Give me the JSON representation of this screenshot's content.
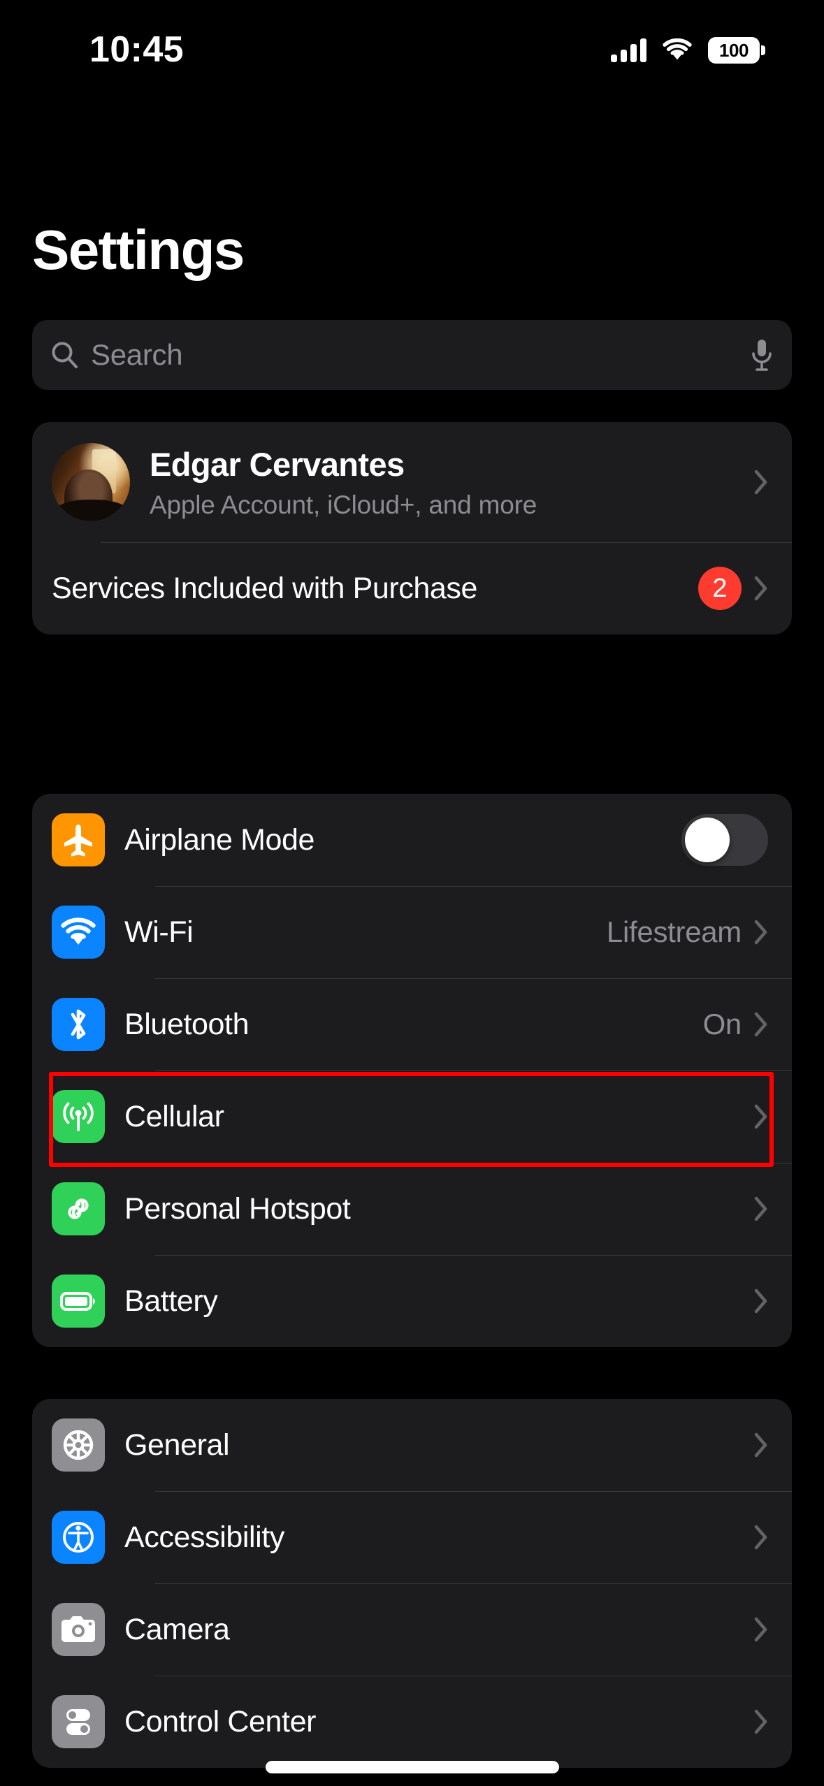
{
  "status_bar": {
    "time": "10:45",
    "signal_icon": "cellular-signal-icon",
    "signal_bars": 4,
    "wifi_icon": "wifi-icon",
    "battery_icon": "battery-icon",
    "battery_percent": "100"
  },
  "header": {
    "title": "Settings"
  },
  "search": {
    "placeholder": "Search",
    "search_icon": "search-icon",
    "mic_icon": "microphone-icon"
  },
  "account_card": {
    "avatar_icon": "user-avatar-photo",
    "name": "Edgar Cervantes",
    "subtitle": "Apple Account, iCloud+, and more",
    "services_label": "Services Included with Purchase",
    "services_badge": "2",
    "badge_color": "#FF3B30",
    "chevron_icon": "chevron-right-icon"
  },
  "connectivity_group": {
    "rows": [
      {
        "label": "Airplane Mode",
        "icon": "airplane-icon",
        "icon_color": "#FF9500",
        "control": "toggle",
        "toggle_on": false,
        "value": ""
      },
      {
        "label": "Wi-Fi",
        "icon": "wifi-icon",
        "icon_color": "#0A84FF",
        "control": "chevron",
        "value": "Lifestream"
      },
      {
        "label": "Bluetooth",
        "icon": "bluetooth-icon",
        "icon_color": "#0A84FF",
        "control": "chevron",
        "value": "On"
      },
      {
        "label": "Cellular",
        "icon": "cellular-icon",
        "icon_color": "#30D158",
        "control": "chevron",
        "value": ""
      },
      {
        "label": "Personal Hotspot",
        "icon": "personal-hotspot-icon",
        "icon_color": "#30D158",
        "control": "chevron",
        "value": ""
      },
      {
        "label": "Battery",
        "icon": "battery-icon",
        "icon_color": "#30D158",
        "control": "chevron",
        "value": ""
      }
    ]
  },
  "system_group": {
    "rows": [
      {
        "label": "General",
        "icon": "gear-icon",
        "icon_color": "#8E8E93",
        "control": "chevron",
        "value": ""
      },
      {
        "label": "Accessibility",
        "icon": "accessibility-icon",
        "icon_color": "#0A84FF",
        "control": "chevron",
        "value": ""
      },
      {
        "label": "Camera",
        "icon": "camera-icon",
        "icon_color": "#8E8E93",
        "control": "chevron",
        "value": ""
      },
      {
        "label": "Control Center",
        "icon": "control-center-icon",
        "icon_color": "#8E8E93",
        "control": "chevron",
        "value": ""
      }
    ]
  },
  "annotation": {
    "highlight_target": "Cellular",
    "highlight_color": "#FF0000"
  },
  "home_indicator": "home-indicator"
}
